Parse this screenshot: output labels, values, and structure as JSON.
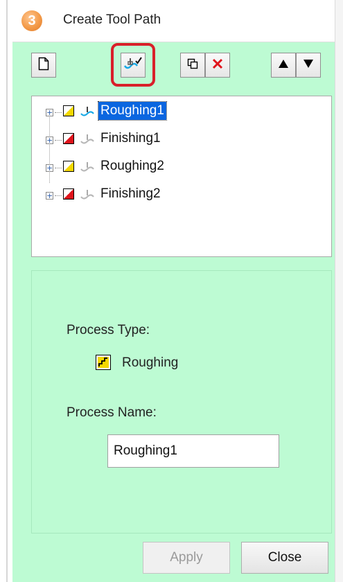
{
  "window": {
    "title": "Create Tool Path",
    "badge_number": "3"
  },
  "toolbar": {
    "buttons": [
      {
        "name": "new",
        "icon": "new-document-icon"
      },
      {
        "name": "create-toolpath",
        "icon": "toolpath-check-icon",
        "highlighted": true
      },
      {
        "name": "copy",
        "icon": "copy-icon"
      },
      {
        "name": "delete",
        "icon": "delete-x-icon"
      },
      {
        "name": "move-up",
        "icon": "triangle-up-icon"
      },
      {
        "name": "move-down",
        "icon": "triangle-down-icon"
      }
    ]
  },
  "tree": {
    "items": [
      {
        "label": "Roughing1",
        "type": "roughing",
        "selected": true
      },
      {
        "label": "Finishing1",
        "type": "finishing",
        "selected": false
      },
      {
        "label": "Roughing2",
        "type": "roughing",
        "selected": false
      },
      {
        "label": "Finishing2",
        "type": "finishing",
        "selected": false
      }
    ]
  },
  "details": {
    "process_type_label": "Process Type:",
    "process_type_value": "Roughing",
    "process_name_label": "Process Name:",
    "process_name_value": "Roughing1"
  },
  "buttons": {
    "apply": "Apply",
    "close": "Close"
  },
  "colors": {
    "panel_bg": "#bdfbd3",
    "selection": "#0a66e0",
    "highlight": "#d9202a",
    "roughing": "#f5d800",
    "finishing": "#e0141c"
  }
}
